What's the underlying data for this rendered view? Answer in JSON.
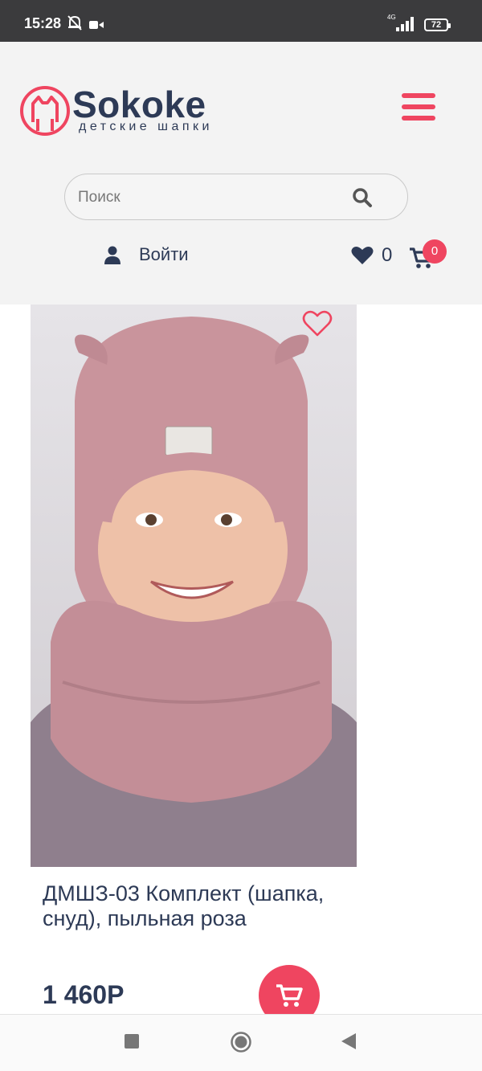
{
  "status_bar": {
    "time": "15:28",
    "network": "4G",
    "battery": "72",
    "icons": [
      "mute-icon",
      "video-icon",
      "signal-icon",
      "battery-icon"
    ]
  },
  "header": {
    "logo_name": "Sokoke",
    "logo_tagline": "детские шапки",
    "search": {
      "placeholder": "Поиск",
      "value": ""
    },
    "login_label": "Войти",
    "wishlist_count": "0",
    "cart_count": "0"
  },
  "product": {
    "title": "ДМШЗ-03 Комплект (шапка, снуд), пыльная роза",
    "price": "1 460Р",
    "image_description": "child in dusty pink knitted hat with cat ears and snood"
  },
  "colors": {
    "accent": "#ef4560",
    "brand_text": "#2d3a56",
    "header_bg": "#f3f3f3",
    "status_bar_bg": "#3b3b3d",
    "product_pink": "#c9949c"
  }
}
